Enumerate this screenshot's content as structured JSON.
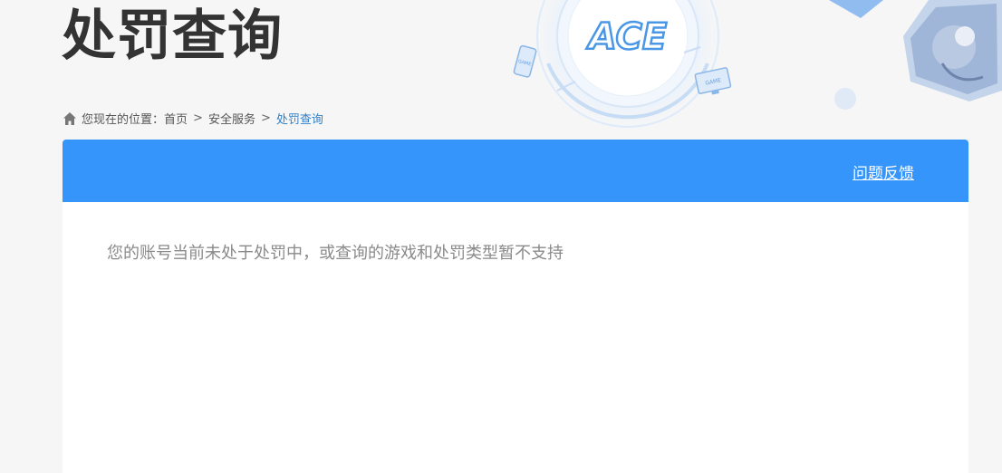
{
  "page": {
    "title": "处罚查询"
  },
  "logo": {
    "text": "ACE",
    "game_badge": "GAME"
  },
  "breadcrumb": {
    "prefix": "您现在的位置：",
    "items": [
      "首页",
      "安全服务",
      "处罚查询"
    ],
    "separator": ">"
  },
  "panel": {
    "feedback_link": "问题反馈",
    "message": "您的账号当前未处于处罚中，或查询的游戏和处罚类型暂不支持"
  },
  "colors": {
    "accent": "#3595fb",
    "title": "#333333",
    "breadcrumb_current": "#2f7fc9",
    "message": "#8a8a8a",
    "background": "#f6f6f6"
  },
  "icons": {
    "home": "home-icon",
    "logo": "ace-logo",
    "phone": "phone-game-icon",
    "monitor": "monitor-game-icon"
  }
}
